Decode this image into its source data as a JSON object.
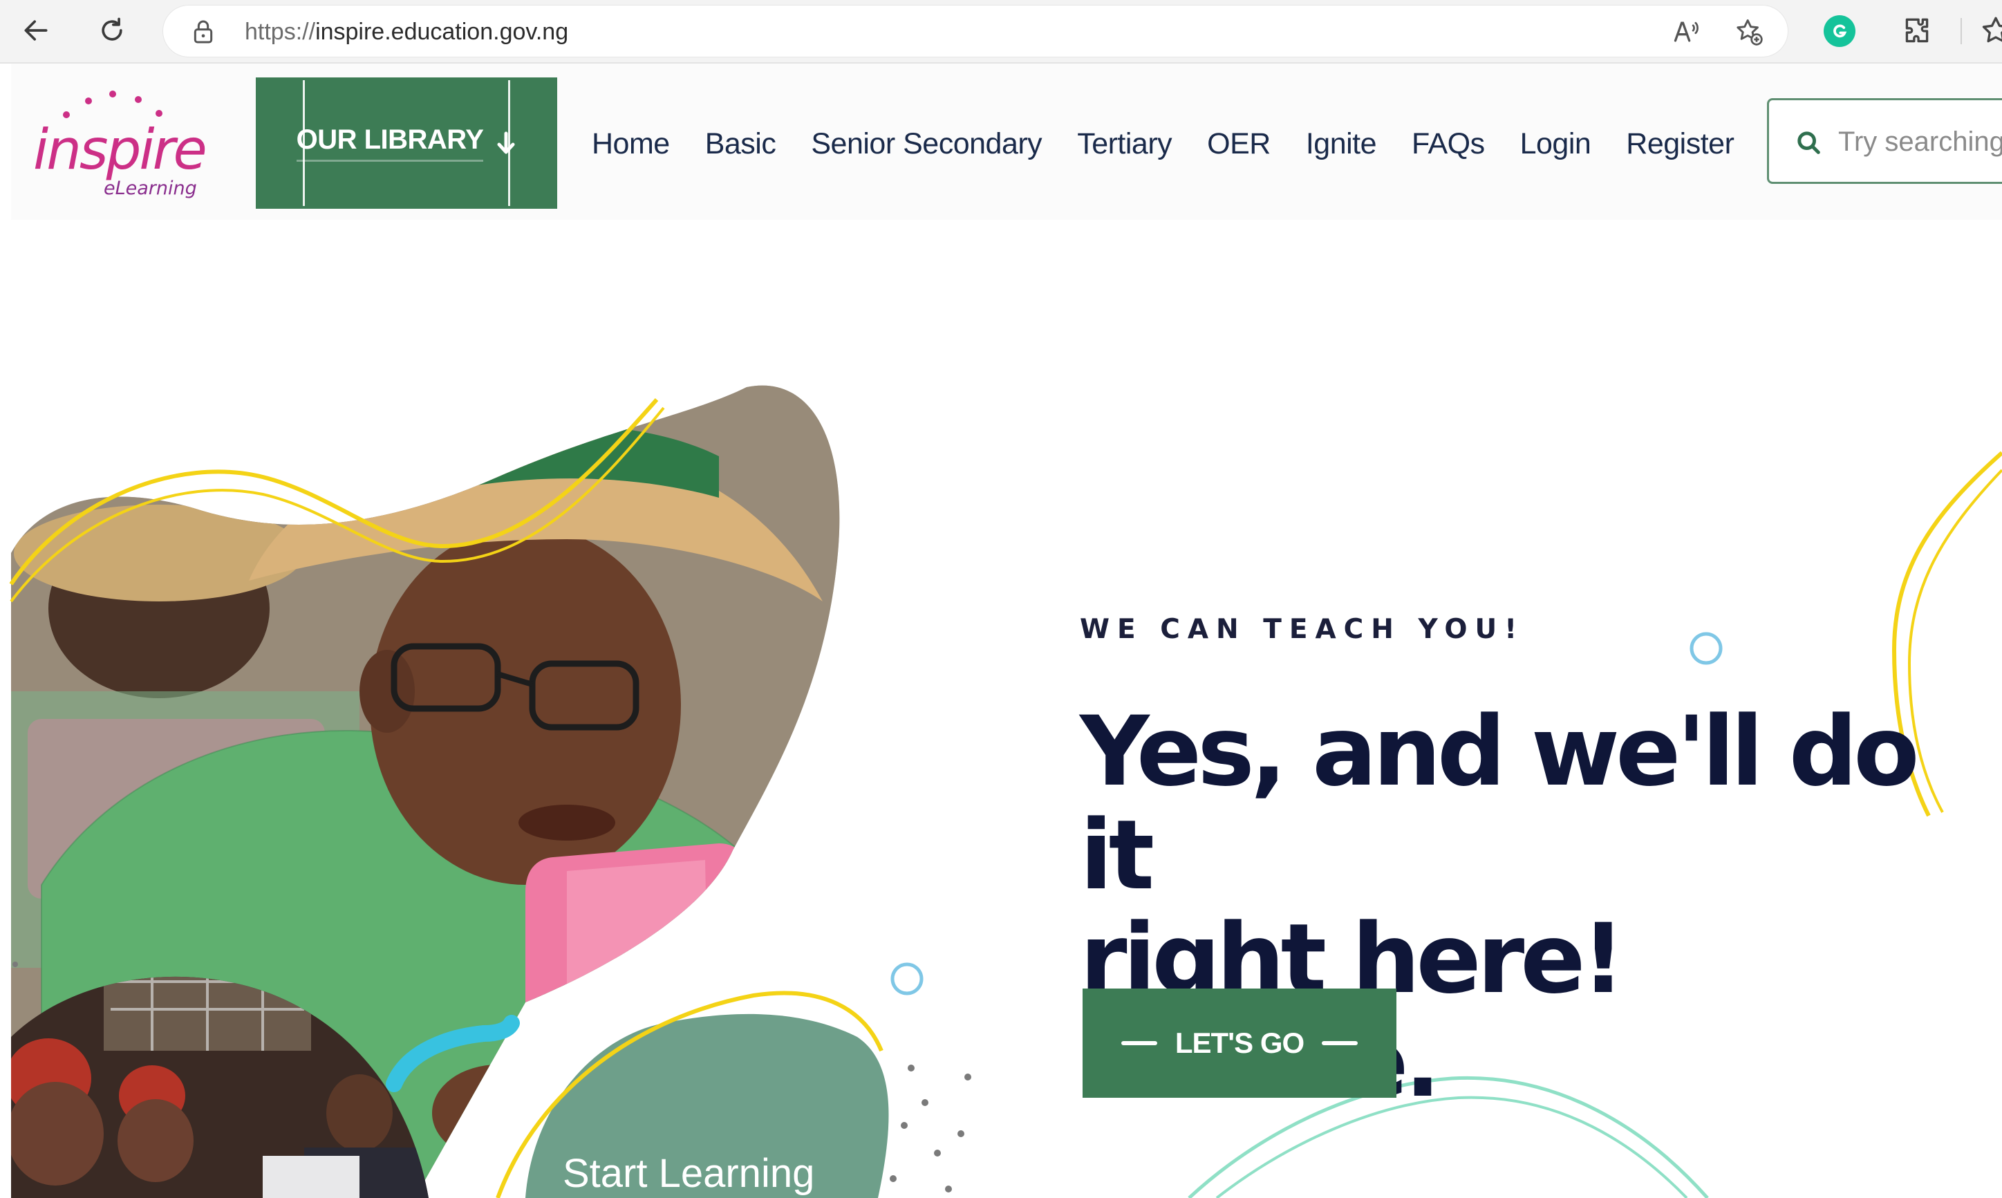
{
  "browser": {
    "url_prefix": "https://",
    "url_domain": "inspire.education.gov.ng",
    "icons": [
      "back-arrow-icon",
      "reload-icon",
      "lock-icon",
      "read-aloud-icon",
      "add-favorite-icon",
      "grammarly-icon",
      "extensions-icon",
      "favorites-icon"
    ]
  },
  "logo": {
    "word": "inspire",
    "sub": "eLearning"
  },
  "library": {
    "label": "OUR LIBRARY"
  },
  "nav": {
    "items": [
      "Home",
      "Basic",
      "Senior Secondary",
      "Tertiary",
      "OER",
      "Ignite",
      "FAQs",
      "Login",
      "Register"
    ]
  },
  "search": {
    "placeholder": "Try searching"
  },
  "hero": {
    "kicker": "WE CAN TEACH YOU!",
    "title_line1": "Yes, and we'll do it",
    "title_line2": "right here! Online.",
    "cta_label": "LET'S GO",
    "start_learning": "Start Learning"
  },
  "colors": {
    "brand_green": "#3d7c55",
    "logo_pink": "#cc2f86",
    "heading_navy": "#0f1638",
    "accent_yellow": "#f4d316",
    "accent_mint": "#8fe0c6",
    "blob_teal": "#6e9f8a"
  }
}
